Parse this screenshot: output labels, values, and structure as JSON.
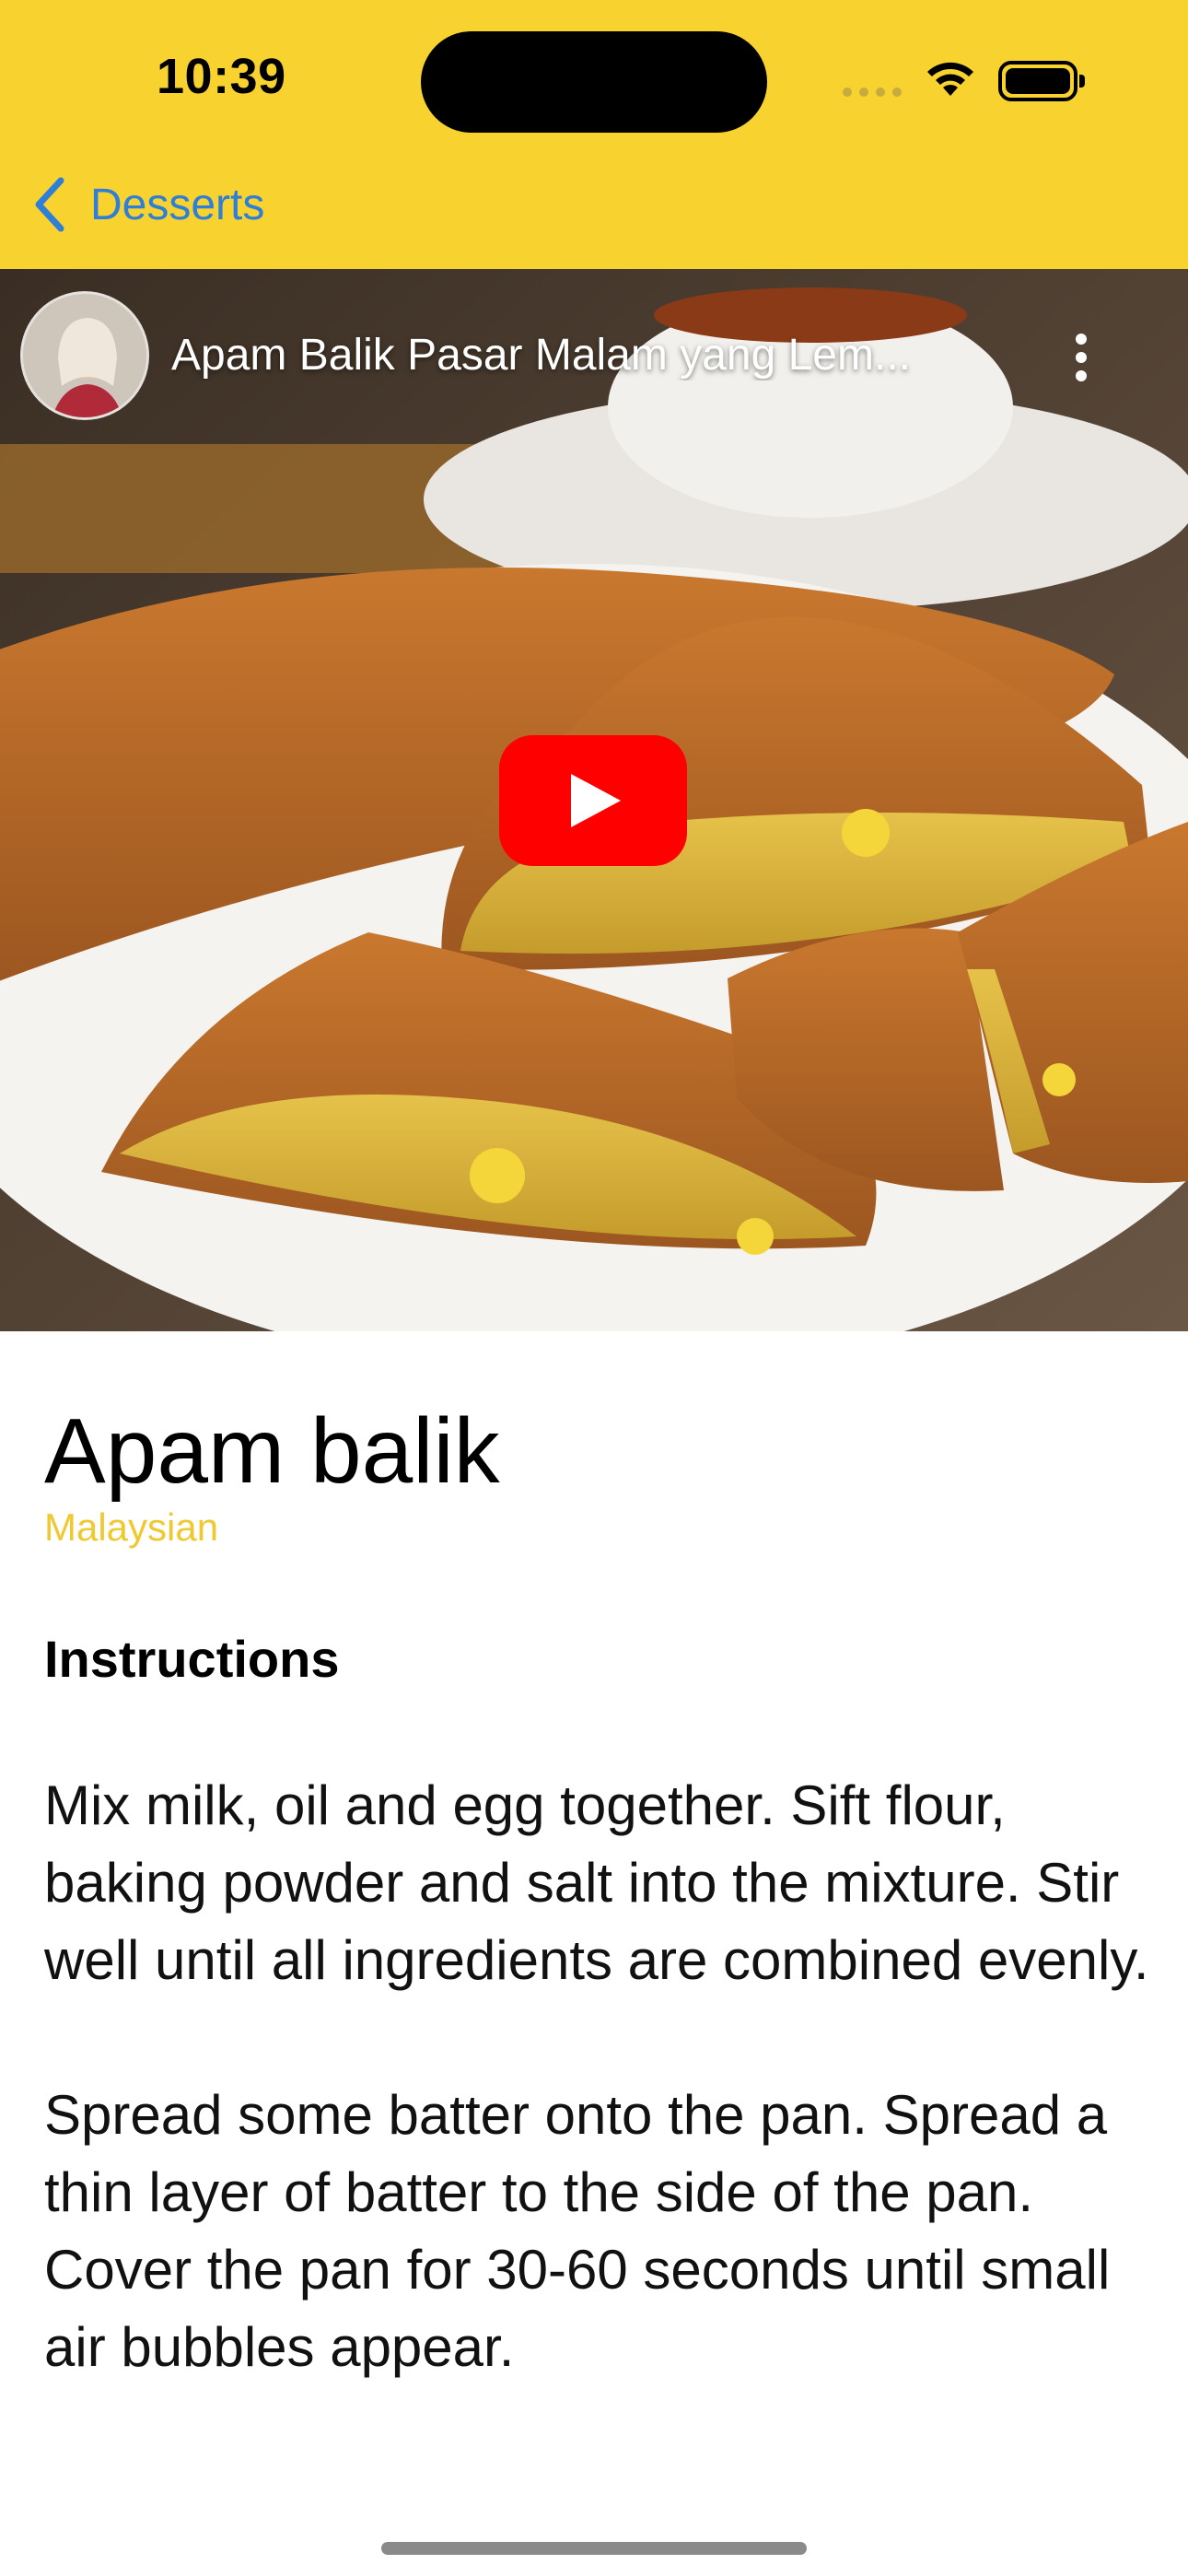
{
  "status_bar": {
    "time": "10:39"
  },
  "nav": {
    "back_label": "Desserts"
  },
  "video": {
    "title": "Apam Balik Pasar Malam yang Lem..."
  },
  "meal": {
    "name": "Apam balik",
    "cuisine": "Malaysian",
    "section_title": "Instructions",
    "instructions": [
      "Mix milk, oil and egg together. Sift flour, baking powder and salt into the mixture. Stir well until all ingredients are combined evenly.",
      "Spread some batter onto the pan. Spread a thin layer of batter to the side of the pan. Cover the pan for 30-60 seconds until small air bubbles appear."
    ]
  },
  "colors": {
    "header_yellow": "#f8d22e",
    "back_blue": "#2f7ed8",
    "cuisine_yellow": "#f0c830",
    "youtube_red": "#ff0000"
  },
  "icons": [
    "back-chevron-icon",
    "wifi-icon",
    "battery-icon",
    "kebab-menu-icon",
    "play-icon"
  ]
}
